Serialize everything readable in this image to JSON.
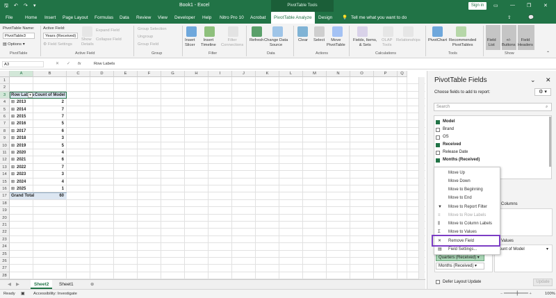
{
  "titlebar": {
    "title": "Book1 - Excel",
    "context_label": "PivotTable Tools",
    "sign_in": "Sign in"
  },
  "tabs": [
    "File",
    "Home",
    "Insert",
    "Page Layout",
    "Formulas",
    "Data",
    "Review",
    "View",
    "Developer",
    "Help",
    "Nitro Pro 10",
    "Acrobat",
    "PivotTable Analyze",
    "Design"
  ],
  "tell_me": "Tell me what you want to do",
  "ribbon": {
    "pt_name_label": "PivotTable Name:",
    "pt_name_value": "PivotTable3",
    "options": "Options",
    "active_field_label": "Active Field:",
    "active_field_value": "Years (Received)",
    "field_settings": "Field Settings",
    "drill_down": "Drill\nDown",
    "drill_up": "Drill\nUp",
    "show_details": "Show\nDetails",
    "expand_field": "Expand Field",
    "collapse_field": "Collapse Field",
    "group_selection": "Group Selection",
    "ungroup": "Ungroup",
    "group_field": "Group Field",
    "insert_slicer": "Insert\nSlicer",
    "insert_timeline": "Insert\nTimeline",
    "filter_connections": "Filter\nConnections",
    "refresh": "Refresh",
    "change_data_source": "Change Data\nSource",
    "clear": "Clear",
    "select": "Select",
    "move_pivottable": "Move\nPivotTable",
    "fields_items_sets": "Fields, Items,\n& Sets",
    "olap_tools": "OLAP\nTools",
    "relationships": "Relationships",
    "pivotchart": "PivotChart",
    "recommended_pivottables": "Recommended\nPivotTables",
    "field_list": "Field\nList",
    "buttons": "+/-\nButtons",
    "field_headers": "Field\nHeaders",
    "groups": {
      "pivottable": "PivotTable",
      "active_field": "Active Field",
      "group": "Group",
      "filter": "Filter",
      "data": "Data",
      "actions": "Actions",
      "calculations": "Calculations",
      "tools": "Tools",
      "show": "Show"
    }
  },
  "formula_bar": {
    "name_box": "A3",
    "fx": "fx",
    "content": "Row Labels"
  },
  "columns": [
    "A",
    "B",
    "C",
    "D",
    "E",
    "F",
    "G",
    "H",
    "I",
    "J",
    "K",
    "L",
    "M",
    "N",
    "O",
    "P",
    "Q"
  ],
  "rows": [
    "1",
    "2",
    "3",
    "4",
    "5",
    "6",
    "7",
    "8",
    "9",
    "10",
    "11",
    "12",
    "13",
    "14",
    "15",
    "16",
    "17",
    "18",
    "19",
    "20",
    "21",
    "22",
    "23",
    "24",
    "25",
    "26",
    "27",
    "28"
  ],
  "pivot": {
    "header": [
      "Row Labels",
      "Count of Model"
    ],
    "rows": [
      [
        "2013",
        "2"
      ],
      [
        "2014",
        "7"
      ],
      [
        "2015",
        "7"
      ],
      [
        "2016",
        "5"
      ],
      [
        "2017",
        "6"
      ],
      [
        "2018",
        "3"
      ],
      [
        "2019",
        "5"
      ],
      [
        "2020",
        "4"
      ],
      [
        "2021",
        "6"
      ],
      [
        "2022",
        "7"
      ],
      [
        "2023",
        "3"
      ],
      [
        "2024",
        "4"
      ],
      [
        "2025",
        "1"
      ]
    ],
    "total": [
      "Grand Total",
      "60"
    ]
  },
  "sheets": [
    "Sheet2",
    "Sheet1"
  ],
  "status": {
    "ready": "Ready",
    "accessibility": "Accessibility: Investigate",
    "zoom": "100%"
  },
  "pane": {
    "title": "PivotTable Fields",
    "subtitle": "Choose fields to add to report:",
    "search": "Search",
    "fields": [
      {
        "name": "Model",
        "checked": true
      },
      {
        "name": "Brand",
        "checked": false
      },
      {
        "name": "OS",
        "checked": false
      },
      {
        "name": "Received",
        "checked": true
      },
      {
        "name": "Release Date",
        "checked": false
      },
      {
        "name": "Months (Received)",
        "checked": true
      }
    ],
    "columns_label": "Columns",
    "values_label": "Values",
    "values_item": "Count of Model",
    "rows_items": [
      "Quarters (Received)",
      "Months (Received)"
    ],
    "defer": "Defer Layout Update",
    "update": "Update"
  },
  "context_menu": [
    "Move Up",
    "Move Down",
    "Move to Beginning",
    "Move to End",
    "Move to Report Filter",
    "Move to Row Labels",
    "Move to Column Labels",
    "Move to Values",
    "Remove Field",
    "Field Settings..."
  ],
  "colors": {
    "excel_green": "#217346",
    "highlight": "#7b3cc4"
  }
}
